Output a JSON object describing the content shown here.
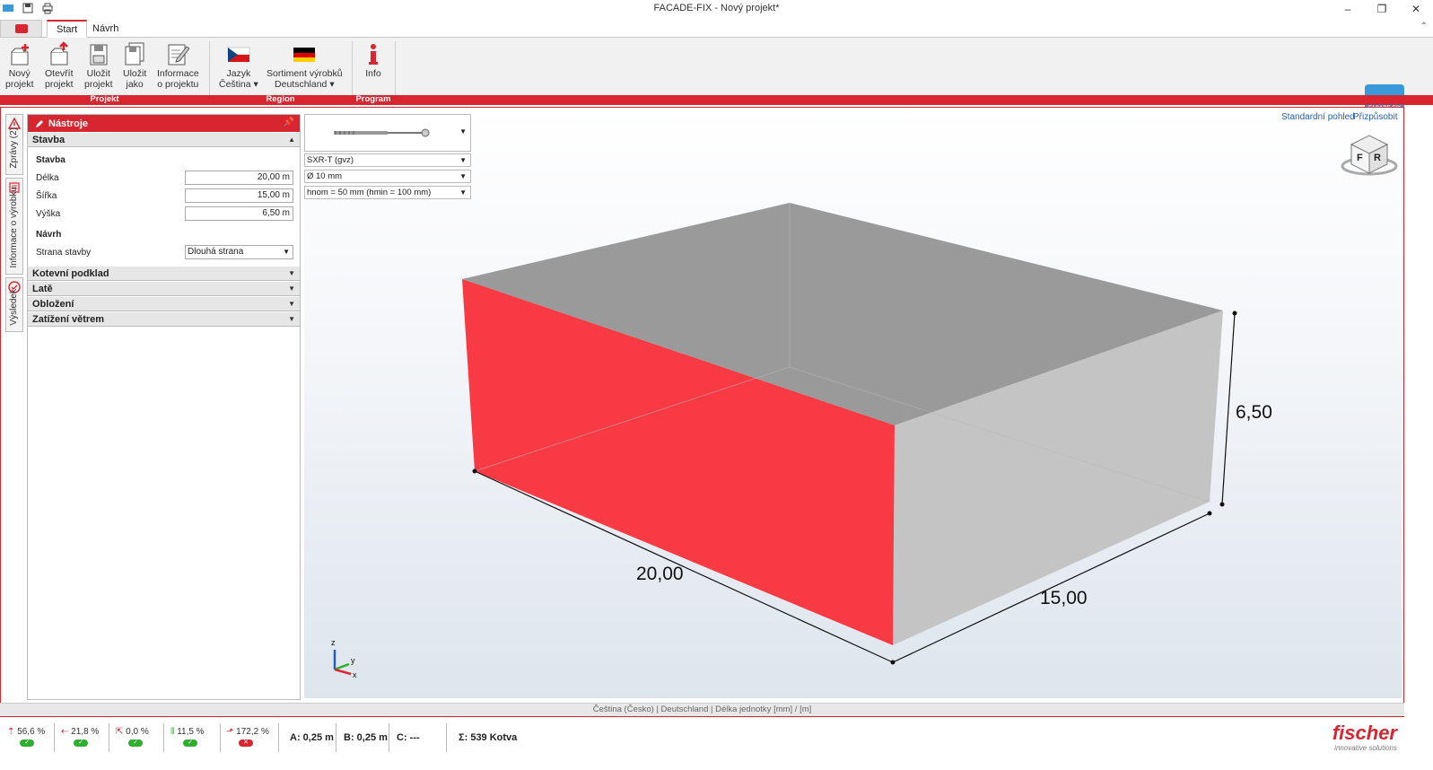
{
  "window": {
    "title": "FACADE-FIX - Nový projekt*"
  },
  "tabs": [
    {
      "label": "Start"
    },
    {
      "label": "Návrh"
    }
  ],
  "ribbon": {
    "buttons": [
      {
        "label1": "Nový",
        "label2": "projekt"
      },
      {
        "label1": "Otevřít",
        "label2": "projekt"
      },
      {
        "label1": "Uložit",
        "label2": "projekt"
      },
      {
        "label1": "Uložit",
        "label2": "jako"
      },
      {
        "label1": "Informace",
        "label2": "o projektu"
      },
      {
        "label1": "Jazyk",
        "label2": "Čeština ▾"
      },
      {
        "label1": "Sortiment výrobků",
        "label2": "Deutschland ▾"
      },
      {
        "label1": "Info",
        "label2": ""
      }
    ],
    "groups": [
      "Projekt",
      "Region",
      "Program"
    ],
    "logo_text": "FACADE-FIX"
  },
  "side_tabs": [
    "Zprávy (2)",
    "Informace o výrobku",
    "Výsledek"
  ],
  "panel": {
    "title": "Nástroje",
    "section_stavba": "Stavba",
    "sub_stavba": "Stavba",
    "fields": [
      {
        "label": "Délka",
        "value": "20,00 m"
      },
      {
        "label": "Šířka",
        "value": "15,00 m"
      },
      {
        "label": "Výška",
        "value": "6,50 m"
      }
    ],
    "sub_navrh": "Návrh",
    "strana_label": "Strana stavby",
    "strana_value": "Dlouhá strana",
    "sections": [
      "Kotevní podklad",
      "Latě",
      "Obložení",
      "Zatížení větrem"
    ]
  },
  "product": {
    "type": "SXR-T (gvz)",
    "diameter": "Ø 10 mm",
    "embedment": "hnom = 50 mm (hmin = 100 mm)"
  },
  "view": {
    "standard_view": "Standardní pohled",
    "fit": "Přizpůsobit",
    "cube_f": "F",
    "cube_r": "R",
    "dim_length": "20,00",
    "dim_width": "15,00",
    "dim_height": "6,50",
    "axis_z": "z",
    "axis_y": "y",
    "axis_x": "x",
    "highlight_color": "#f73a44"
  },
  "statusbar": {
    "text": "Čeština (Česko) | Deutschland | Délka jednotky [mm] / [m]"
  },
  "indicators": [
    {
      "value": "56,6 %",
      "ok": true
    },
    {
      "value": "21,8 %",
      "ok": true
    },
    {
      "value": "0,0 %",
      "ok": true
    },
    {
      "value": "11,5 %",
      "ok": true
    },
    {
      "value": "172,2 %",
      "ok": false
    }
  ],
  "bottom": {
    "a": "A: 0,25 m",
    "b": "B: 0,25 m",
    "c": "C: ---",
    "sum": "Σ: 539 Kotva",
    "brand": "fischer",
    "brand_sub": "innovative solutions"
  }
}
